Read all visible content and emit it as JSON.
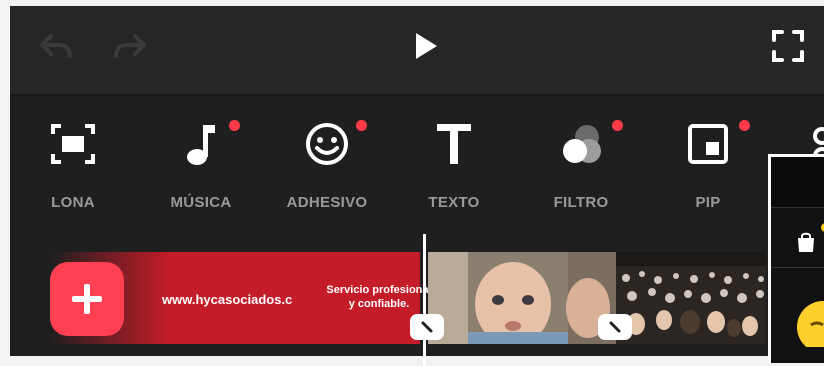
{
  "topbar": {
    "undo_icon": "undo-icon",
    "redo_icon": "redo-icon",
    "play_icon": "play-icon",
    "fullscreen_icon": "fullscreen-icon"
  },
  "tools": [
    {
      "label": "LONA",
      "icon": "canvas-icon",
      "badge": false
    },
    {
      "label": "MÚSICA",
      "icon": "music-note-icon",
      "badge": true
    },
    {
      "label": "ADHESIVO",
      "icon": "smiley-icon",
      "badge": true
    },
    {
      "label": "TEXTO",
      "icon": "text-icon",
      "badge": false
    },
    {
      "label": "FILTRO",
      "icon": "filter-icon",
      "badge": true
    },
    {
      "label": "PIP",
      "icon": "pip-icon",
      "badge": true
    }
  ],
  "timeline": {
    "clip_url_text": "www.hycasociados.c",
    "clip_tagline": "Servicio profesional\ny confiable.",
    "add_icon": "plus-icon"
  },
  "colors": {
    "accent": "#ff3f52",
    "badge": "#ff3b4a",
    "clip_red": "#c41c29",
    "panel": "#1f1f1f"
  }
}
